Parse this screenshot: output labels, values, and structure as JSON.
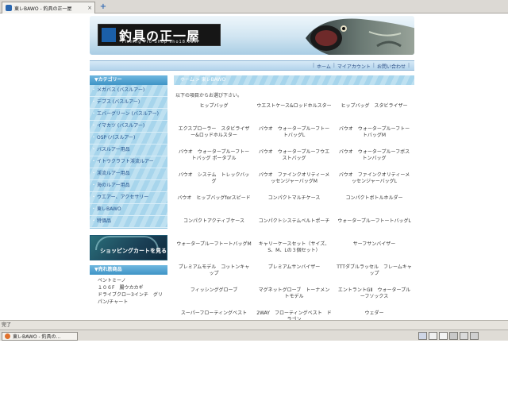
{
  "browser": {
    "tab_title": "東レBAWO - 釣具の正一屋",
    "new_tab_symbol": "+",
    "close_symbol": "×"
  },
  "banner": {
    "logo_title": "釣具の正一屋",
    "logo_subtitle": "Fishing Pro Shop sho18.com"
  },
  "nav": {
    "items": [
      "ホーム",
      "マイアカウント",
      "お問い合わせ"
    ],
    "separator": "|"
  },
  "sidebar": {
    "category_heading": "▼カテゴリー",
    "categories": [
      "メガバス (バスルアー)",
      "デプス (バスルアー)",
      "エバーグリーン (バスルアー)",
      "イマカツ (バスルアー)",
      "OSP (バスルアー)",
      "バスルアー用品",
      "イトウクラフト渓流ルアー",
      "渓流ルアー用品",
      "海のルアー用品",
      "ウエアー、アクセサリー",
      "東レBAWO",
      "特価品"
    ],
    "cart_banner_text": "ショッピングカートを見る",
    "bestseller_heading": "▼売れ筋商品",
    "bestsellers": [
      "ペントミーノ",
      "１０６F　腸ウカカギ",
      "ドライブクロー3インチ　グリパン/チャート"
    ]
  },
  "main": {
    "breadcrumb": "ホーム > 東レBAWO",
    "intro": "以下の項目からお選び下さい。",
    "items": [
      "ヒップバッグ",
      "ウエストケース&ロッドホルスター",
      "ヒップバッグ　スタビライザー",
      "エクスプローラー　スタビライザー&ロッドホルスター",
      "バウオ　ウォータープルーフトートバッグL",
      "バウオ　ウォータープルーフトートバッグM",
      "バウオ　ウォータープルーフトートバッグ ポータブル",
      "バウオ　ウォータープルーフウエストバッグ",
      "バウオ　ウォータープルーフボストンバッグ",
      "バウオ　システム　トレックバッグ",
      "バウオ　ファインクオリティーメッセンジャーバッグM",
      "バウオ　ファインクオリティーメッセンジャーバッグL",
      "バウオ　ヒップバッグforスピード",
      "コンパクトマルチケース",
      "コンパクトボトルホルダー",
      "コンパクトアクティブケース",
      "コンパクトシステムベルトポーチ",
      "ウォータープルーフトートバッグL",
      "ウォータープルーフトートバッグM",
      "キャリーケースセット（サイズ、S、M、Lの３個セット）",
      "サーフサンバイザー",
      "プレミアムモデル　コットンキャップ",
      "プレミアムサンバイザー",
      "TTTダブルラッセル　フレームキャップ",
      "フィッシンググローブ",
      "マグネットグローブ　トーナメントモデル",
      "エントラントGⅡ　ウォータープルーフソックス",
      "スーパーフローティングベスト",
      "2WAY　フローティングベスト　ドラゴン",
      "ウェダー"
    ]
  },
  "status": {
    "text": "完了"
  },
  "taskbar": {
    "window_label": "東レBAWO - 釣具の..."
  }
}
